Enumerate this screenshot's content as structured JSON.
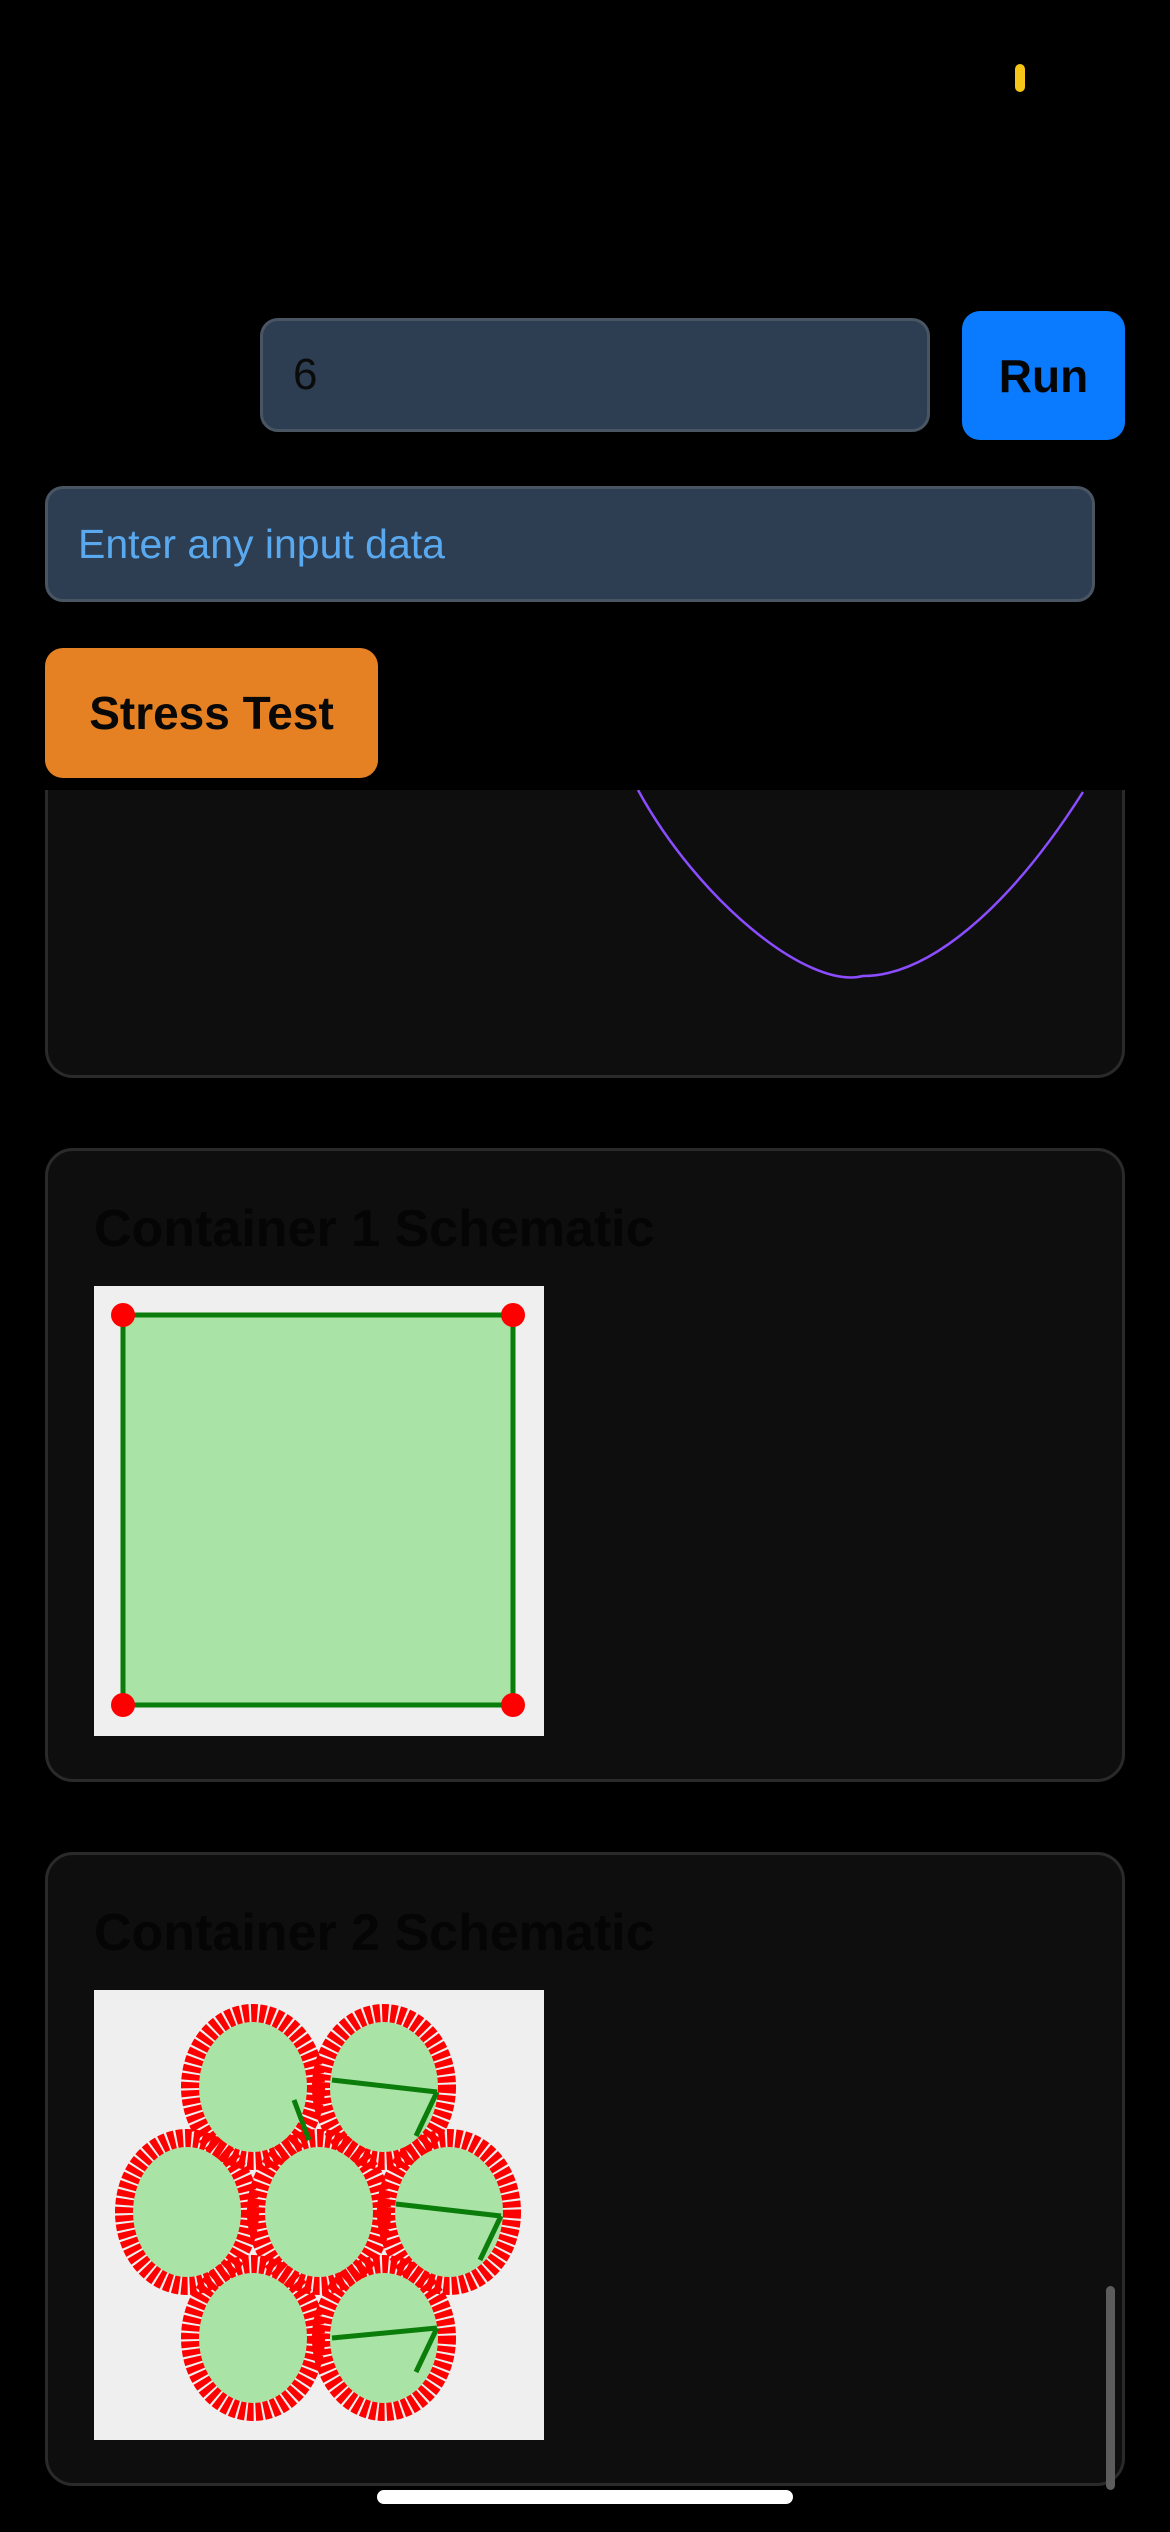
{
  "controls": {
    "number_value": "6",
    "run_label": "Run",
    "data_placeholder": "Enter any input data",
    "data_value": "",
    "stress_label": "Stress Test"
  },
  "plot": {
    "line_color": "#8b4dff"
  },
  "containers": [
    {
      "title": "Container 1 Schematic",
      "circle_count": 0
    },
    {
      "title": "Container 2 Schematic",
      "circle_count": 7
    }
  ],
  "colors": {
    "background": "#000000",
    "card_background": "#0e0e0e",
    "input_background": "#2d3e52",
    "run_button": "#0a7bff",
    "stress_button": "#e68123",
    "placeholder_text": "#5aa9ef",
    "container_fill": "#a9e3a6",
    "container_stroke": "#0a7d0a",
    "vertex_marker": "#ff0000",
    "schematic_background": "#efefef",
    "status_indicator": "#f5c518"
  },
  "icons": {
    "status": "battery-indicator-icon"
  }
}
